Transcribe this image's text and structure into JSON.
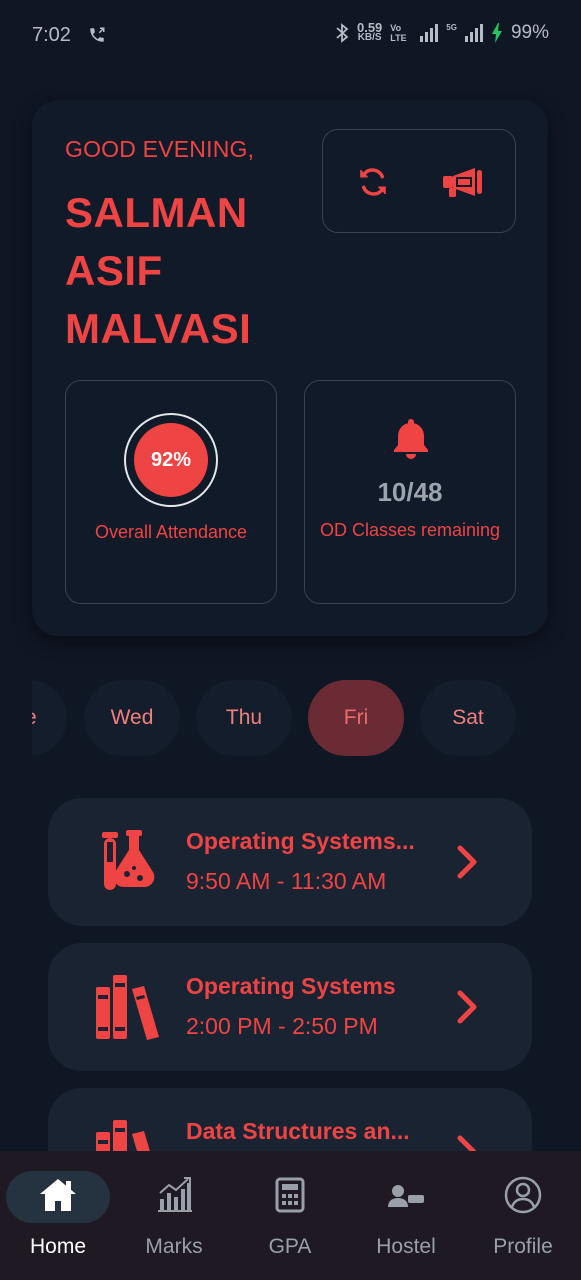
{
  "status_bar": {
    "time": "7:02",
    "net_speed": "0.59",
    "net_unit": "KB/S",
    "volte": "Vo LTE",
    "net_type": "5G",
    "battery": "99%"
  },
  "hero": {
    "greeting": "GOOD EVENING,",
    "name": "SALMAN ASIF MALVASI",
    "attendance": {
      "value": "92%",
      "label": "Overall Attendance",
      "percent": 92
    },
    "od": {
      "count": "10/48",
      "label": "OD Classes remaining"
    }
  },
  "days": [
    {
      "label": "Tue",
      "active": false
    },
    {
      "label": "Wed",
      "active": false
    },
    {
      "label": "Thu",
      "active": false
    },
    {
      "label": "Fri",
      "active": true
    },
    {
      "label": "Sat",
      "active": false
    }
  ],
  "classes": [
    {
      "title": "Operating Systems...",
      "time": "9:50 AM - 11:30 AM",
      "icon": "lab-flask-icon"
    },
    {
      "title": "Operating Systems",
      "time": "2:00 PM - 2:50 PM",
      "icon": "books-icon"
    },
    {
      "title": "Data Structures an...",
      "time": "",
      "icon": "books-icon"
    }
  ],
  "nav": {
    "items": [
      {
        "label": "Home",
        "icon": "home-icon",
        "active": true
      },
      {
        "label": "Marks",
        "icon": "chart-icon",
        "active": false
      },
      {
        "label": "GPA",
        "icon": "calculator-icon",
        "active": false
      },
      {
        "label": "Hostel",
        "icon": "bed-icon",
        "active": false
      },
      {
        "label": "Profile",
        "icon": "profile-icon",
        "active": false
      }
    ]
  },
  "colors": {
    "accent": "#ef4444",
    "background": "#0f1624",
    "card": "#1a2331",
    "nav_background": "#1e1922"
  }
}
